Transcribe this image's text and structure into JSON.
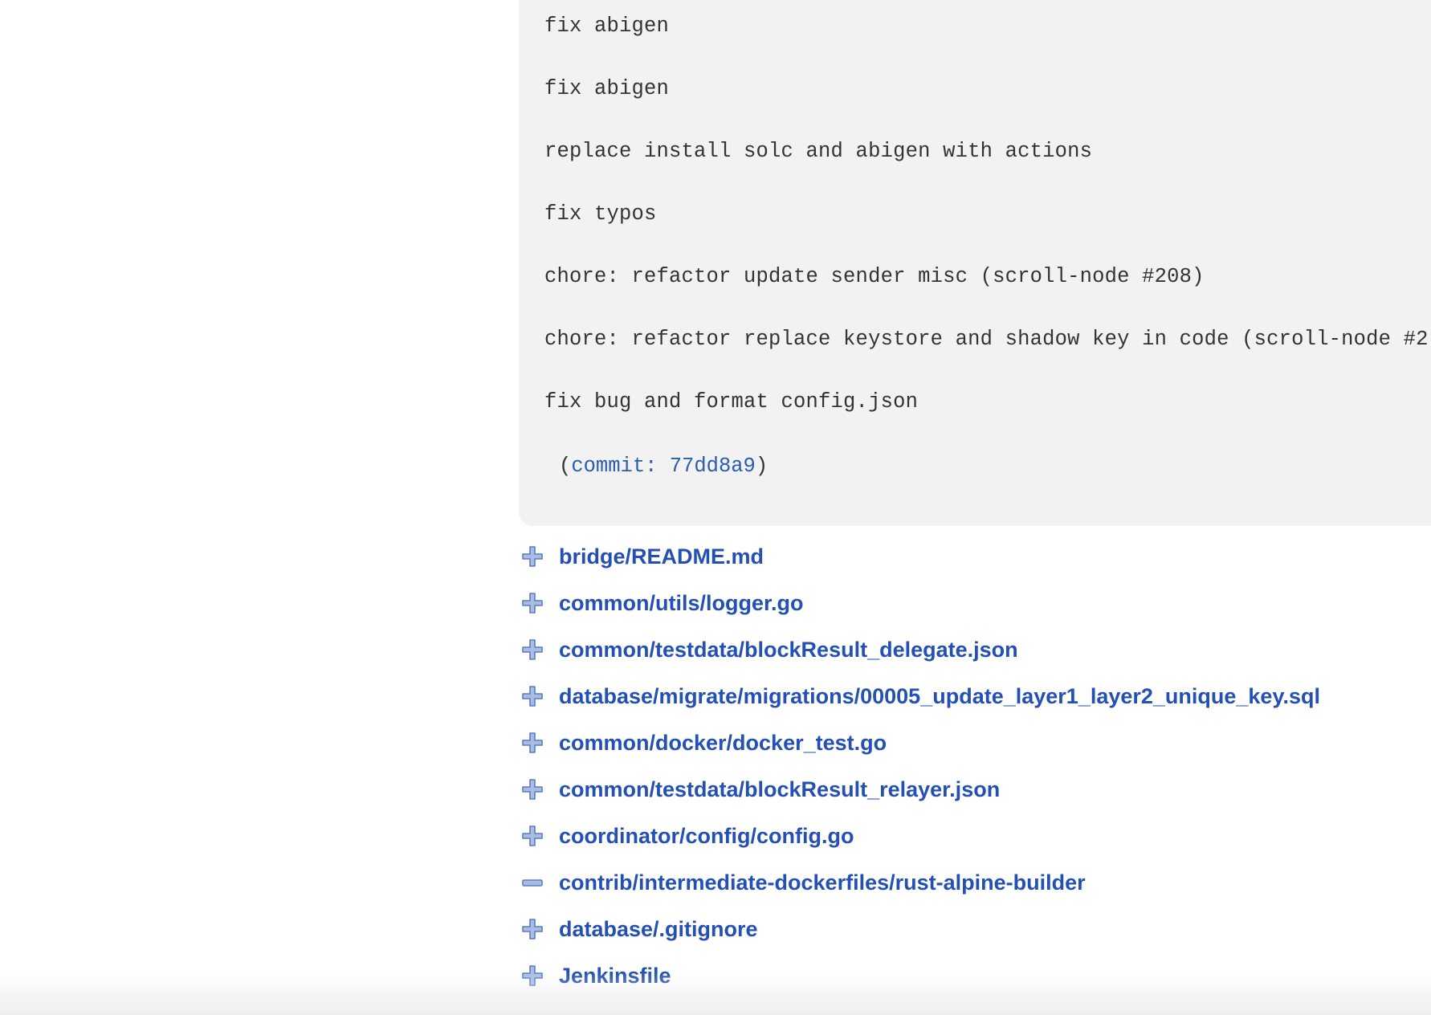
{
  "commit_message": {
    "lines": [
      "fix abigen",
      "fix abigen",
      "replace install solc and abigen with actions",
      "fix typos",
      "chore: refactor update sender misc (scroll-node #208)",
      "chore: refactor replace keystore and shadow key in code (scroll-node #2",
      "fix bug and format config.json"
    ],
    "ref_open": "(",
    "ref_link": "commit: 77dd8a9",
    "ref_close": ")"
  },
  "files": [
    {
      "path": "bridge/README.md",
      "change": "add",
      "icon": "plus-icon"
    },
    {
      "path": "common/utils/logger.go",
      "change": "add",
      "icon": "plus-icon"
    },
    {
      "path": "common/testdata/blockResult_delegate.json",
      "change": "add",
      "icon": "plus-icon"
    },
    {
      "path": "database/migrate/migrations/00005_update_layer1_layer2_unique_key.sql",
      "change": "add",
      "icon": "plus-icon"
    },
    {
      "path": "common/docker/docker_test.go",
      "change": "add",
      "icon": "plus-icon"
    },
    {
      "path": "common/testdata/blockResult_relayer.json",
      "change": "add",
      "icon": "plus-icon"
    },
    {
      "path": "coordinator/config/config.go",
      "change": "add",
      "icon": "plus-icon"
    },
    {
      "path": "contrib/intermediate-dockerfiles/rust-alpine-builder",
      "change": "delete",
      "icon": "minus-icon"
    },
    {
      "path": "database/.gitignore",
      "change": "add",
      "icon": "plus-icon"
    },
    {
      "path": "Jenkinsfile",
      "change": "add",
      "icon": "plus-icon"
    }
  ],
  "colors": {
    "link": "#2450b3",
    "commit_link": "#2a5db0",
    "code_bg": "#f2f2f2",
    "icon_fill": "#a9bde3",
    "icon_stroke": "#5c7cc0"
  }
}
